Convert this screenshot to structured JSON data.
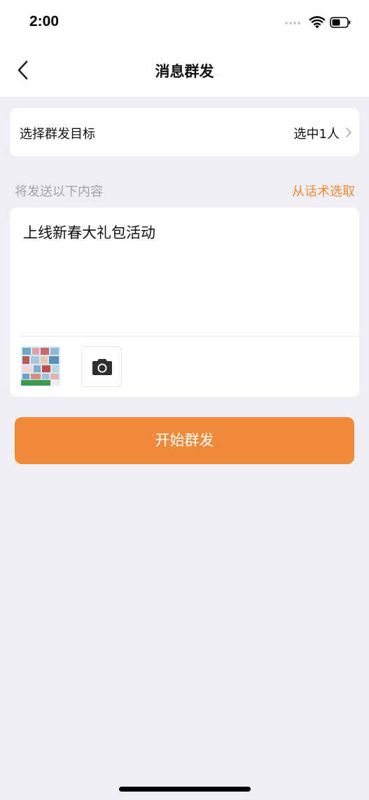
{
  "status_bar": {
    "time": "2:00"
  },
  "nav": {
    "title": "消息群发",
    "back_icon": "chevron-left-icon"
  },
  "target": {
    "label": "选择群发目标",
    "value": "选中1人",
    "icon": "chevron-right-icon"
  },
  "section": {
    "label": "将发送以下内容",
    "link": "从话术选取"
  },
  "content": {
    "message": "上线新春大礼包活动",
    "camera_icon": "camera-icon"
  },
  "actions": {
    "start_label": "开始群发"
  },
  "colors": {
    "accent": "#F08A38",
    "background": "#EEEEF3",
    "card": "#FFFFFF",
    "muted": "#A2A2A8"
  }
}
